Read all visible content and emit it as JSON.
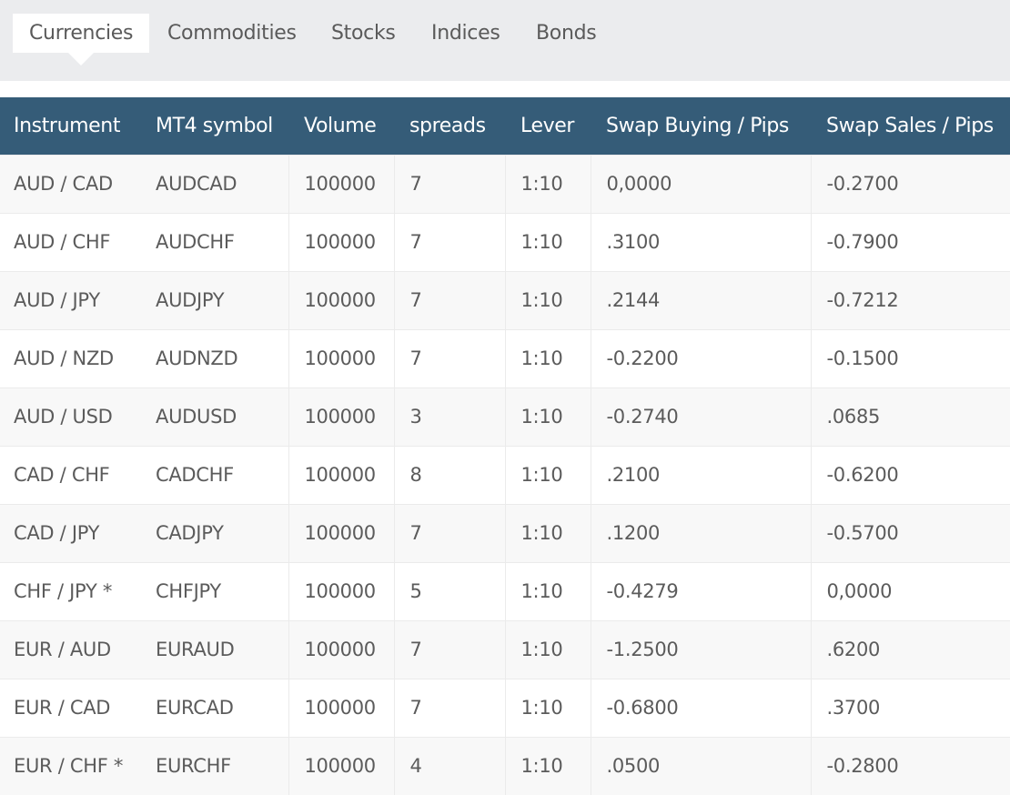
{
  "tabs": [
    {
      "label": "Currencies",
      "active": true
    },
    {
      "label": "Commodities",
      "active": false
    },
    {
      "label": "Stocks",
      "active": false
    },
    {
      "label": "Indices",
      "active": false
    },
    {
      "label": "Bonds",
      "active": false
    }
  ],
  "table": {
    "columns": [
      "Instrument",
      "MT4 symbol",
      "Volume",
      "spreads",
      "Lever",
      "Swap Buying / Pips",
      "Swap Sales / Pips"
    ],
    "header_color": "#355c78",
    "rows": [
      [
        "AUD / CAD",
        "AUDCAD",
        "100000",
        "7",
        "1:10",
        "0,0000",
        "-0.2700"
      ],
      [
        "AUD / CHF",
        "AUDCHF",
        "100000",
        "7",
        "1:10",
        ".3100",
        "-0.7900"
      ],
      [
        "AUD / JPY",
        "AUDJPY",
        "100000",
        "7",
        "1:10",
        ".2144",
        "-0.7212"
      ],
      [
        "AUD / NZD",
        "AUDNZD",
        "100000",
        "7",
        "1:10",
        "-0.2200",
        "-0.1500"
      ],
      [
        "AUD / USD",
        "AUDUSD",
        "100000",
        "3",
        "1:10",
        "-0.2740",
        ".0685"
      ],
      [
        "CAD / CHF",
        "CADCHF",
        "100000",
        "8",
        "1:10",
        ".2100",
        "-0.6200"
      ],
      [
        "CAD / JPY",
        "CADJPY",
        "100000",
        "7",
        "1:10",
        ".1200",
        "-0.5700"
      ],
      [
        "CHF / JPY *",
        "CHFJPY",
        "100000",
        "5",
        "1:10",
        "-0.4279",
        "0,0000"
      ],
      [
        "EUR / AUD",
        "EURAUD",
        "100000",
        "7",
        "1:10",
        "-1.2500",
        ".6200"
      ],
      [
        "EUR / CAD",
        "EURCAD",
        "100000",
        "7",
        "1:10",
        "-0.6800",
        ".3700"
      ],
      [
        "EUR / CHF *",
        "EURCHF",
        "100000",
        "4",
        "1:10",
        ".0500",
        "-0.2800"
      ]
    ]
  }
}
